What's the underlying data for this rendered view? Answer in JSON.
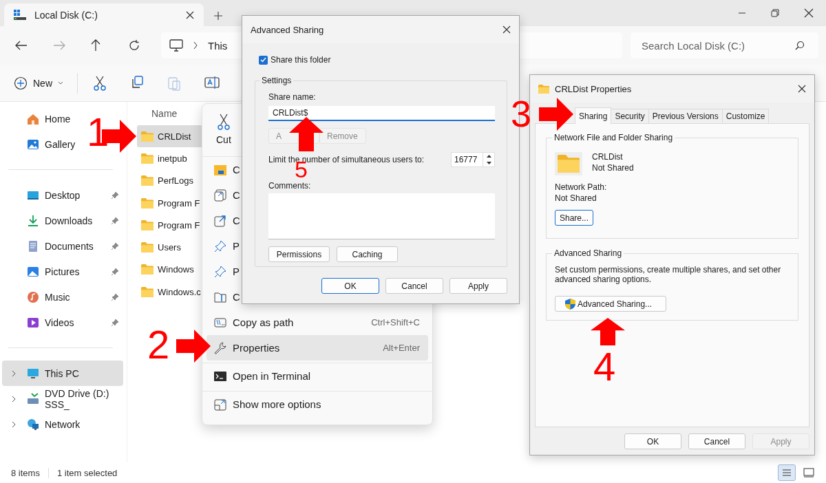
{
  "window": {
    "tab_title": "Local Disk (C:)"
  },
  "address": {
    "crumb": "This"
  },
  "search": {
    "placeholder": "Search Local Disk (C:)"
  },
  "toolbar": {
    "new_label": "New"
  },
  "sidebar": {
    "sections": [
      {
        "kind": "quick",
        "items": [
          {
            "label": "Home",
            "selected": false
          },
          {
            "label": "Gallery",
            "selected": false
          }
        ]
      },
      {
        "kind": "pinned",
        "items": [
          {
            "label": "Desktop",
            "selected": false
          },
          {
            "label": "Downloads",
            "selected": false
          },
          {
            "label": "Documents",
            "selected": false
          },
          {
            "label": "Pictures",
            "selected": false
          },
          {
            "label": "Music",
            "selected": false
          },
          {
            "label": "Videos",
            "selected": false
          }
        ]
      },
      {
        "kind": "tree",
        "items": [
          {
            "label": "This PC",
            "selected": true
          },
          {
            "label": "DVD Drive (D:) SSS_",
            "selected": false
          },
          {
            "label": "Network",
            "selected": false
          }
        ]
      }
    ]
  },
  "file_list": {
    "column": "Name",
    "rows": [
      {
        "name": "CRLDist",
        "selected": true
      },
      {
        "name": "inetpub",
        "selected": false
      },
      {
        "name": "PerfLogs",
        "selected": false
      },
      {
        "name": "Program F",
        "selected": false
      },
      {
        "name": "Program F",
        "selected": false
      },
      {
        "name": "Users",
        "selected": false
      },
      {
        "name": "Windows",
        "selected": false
      },
      {
        "name": "Windows.c",
        "selected": false
      }
    ]
  },
  "status_bar": {
    "item_count": "8 items",
    "selection": "1 item selected",
    "view_buttons": [
      {
        "selected": true
      },
      {
        "selected": false
      }
    ]
  },
  "context_menu": {
    "quick_actions": [
      {
        "label": "Cut"
      }
    ],
    "groups": [
      [
        {
          "label": "C",
          "highlighted": false
        },
        {
          "label": "C",
          "highlighted": false
        },
        {
          "label": "C",
          "highlighted": false
        },
        {
          "label": "P",
          "highlighted": false
        },
        {
          "label": "P",
          "highlighted": false
        },
        {
          "label": "C",
          "highlighted": false
        },
        {
          "label": "Copy as path",
          "shortcut": "Ctrl+Shift+C",
          "highlighted": false
        },
        {
          "label": "Properties",
          "shortcut": "Alt+Enter",
          "highlighted": true
        }
      ],
      [
        {
          "label": "Open in Terminal",
          "highlighted": false
        }
      ],
      [
        {
          "label": "Show more options",
          "highlighted": false
        }
      ]
    ]
  },
  "advanced_sharing": {
    "title": "Advanced Sharing",
    "share_checkbox": {
      "label": "Share this folder",
      "checked": true
    },
    "settings_label": "Settings",
    "share_name_label": "Share name:",
    "share_name": "CRLDist$",
    "add_button": {
      "label": "A",
      "disabled": true
    },
    "remove_button": {
      "label": "Remove",
      "disabled": true
    },
    "limit_label": "Limit the number of simultaneous users to:",
    "limit_value": "16777",
    "comments_label": "Comments:",
    "buttons": [
      {
        "label": "Permissions"
      },
      {
        "label": "Caching"
      }
    ],
    "footer_buttons": [
      {
        "label": "OK",
        "default": true,
        "disabled": false
      },
      {
        "label": "Cancel",
        "default": false,
        "disabled": false
      },
      {
        "label": "Apply",
        "default": false,
        "disabled": false
      }
    ]
  },
  "properties": {
    "title": "CRLDist Properties",
    "tabs": [
      {
        "label": "Sharing",
        "selected": true
      },
      {
        "label": "Security",
        "selected": false
      },
      {
        "label": "Previous Versions",
        "selected": false
      },
      {
        "label": "Customize",
        "selected": false
      }
    ],
    "network_group": {
      "title": "Network File and Folder Sharing",
      "folder_name": "CRLDist",
      "status": "Not Shared",
      "path_label": "Network Path:",
      "path_value": "Not Shared",
      "share_button": {
        "label": "Share...",
        "default": true
      }
    },
    "advanced_group": {
      "title": "Advanced Sharing",
      "description": "Set custom permissions, create multiple shares, and set other advanced sharing options.",
      "button": "Advanced Sharing..."
    },
    "footer_buttons": [
      {
        "label": "OK",
        "default": false,
        "disabled": false
      },
      {
        "label": "Cancel",
        "default": false,
        "disabled": false
      },
      {
        "label": "Apply",
        "default": false,
        "disabled": true
      }
    ]
  },
  "annotations": [
    {
      "label": "1"
    },
    {
      "label": "2"
    },
    {
      "label": "3"
    },
    {
      "label": "4"
    },
    {
      "label": "5"
    }
  ]
}
